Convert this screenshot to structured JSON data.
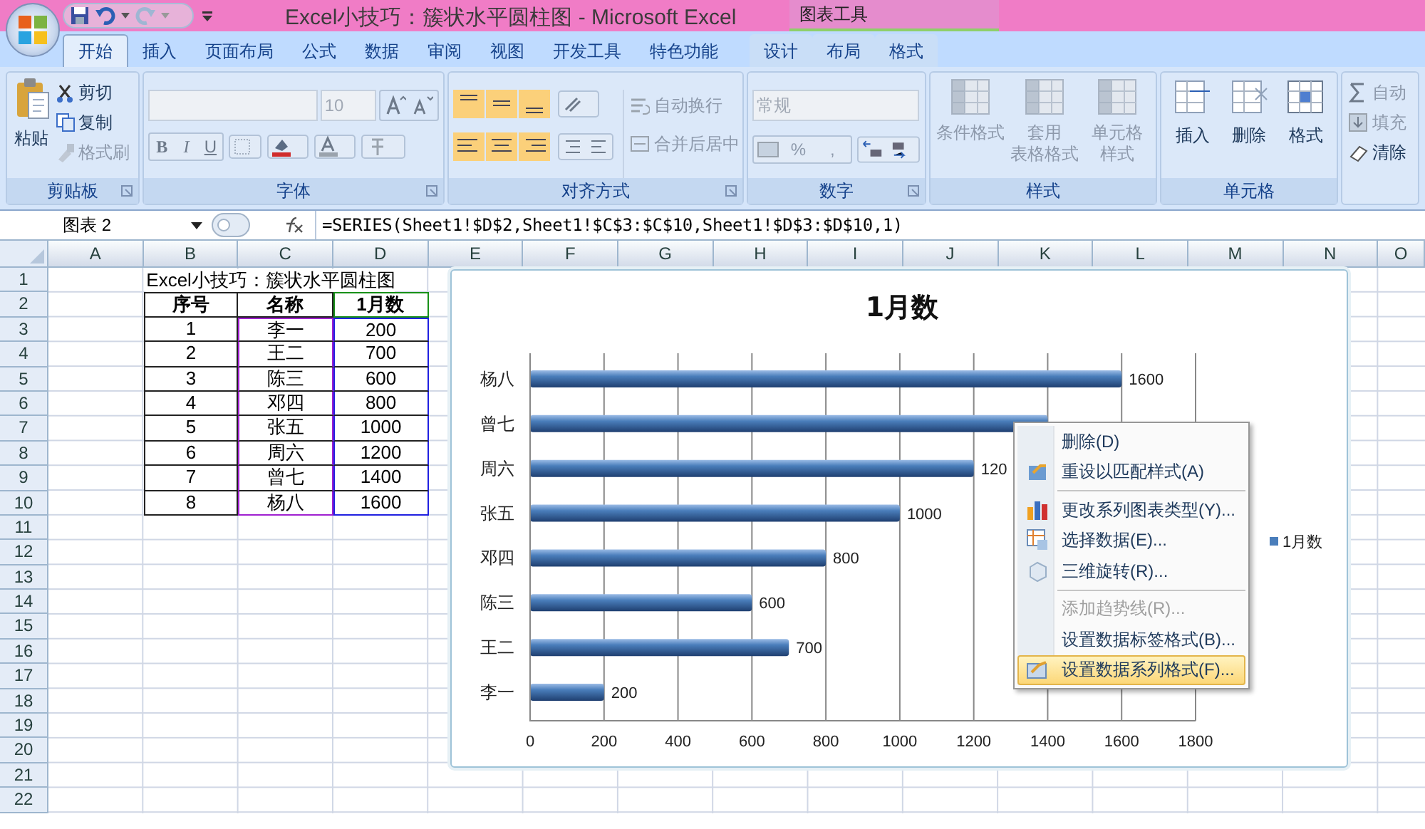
{
  "title_bar": {
    "title": "Excel小技巧：簇状水平圆柱图 - Microsoft Excel",
    "context_label": "图表工具"
  },
  "ribbon_tabs": [
    {
      "label": "开始",
      "selected": true,
      "kind": "standard"
    },
    {
      "label": "插入",
      "selected": false,
      "kind": "standard"
    },
    {
      "label": "页面布局",
      "selected": false,
      "kind": "standard"
    },
    {
      "label": "公式",
      "selected": false,
      "kind": "standard"
    },
    {
      "label": "数据",
      "selected": false,
      "kind": "standard"
    },
    {
      "label": "审阅",
      "selected": false,
      "kind": "standard"
    },
    {
      "label": "视图",
      "selected": false,
      "kind": "standard"
    },
    {
      "label": "开发工具",
      "selected": false,
      "kind": "standard"
    },
    {
      "label": "特色功能",
      "selected": false,
      "kind": "standard"
    },
    {
      "label": "设计",
      "selected": false,
      "kind": "contextual"
    },
    {
      "label": "布局",
      "selected": false,
      "kind": "contextual"
    },
    {
      "label": "格式",
      "selected": false,
      "kind": "contextual"
    }
  ],
  "clipboard": {
    "label": "剪贴板",
    "paste": "粘贴",
    "items": [
      {
        "label": "剪切",
        "disabled": false
      },
      {
        "label": "复制",
        "disabled": false
      },
      {
        "label": "格式刷",
        "disabled": true
      }
    ]
  },
  "font": {
    "label": "字体",
    "font_size": "10",
    "buttons": [
      "B",
      "I",
      "U"
    ]
  },
  "alignment": {
    "label": "对齐方式",
    "items": [
      {
        "label": "自动换行",
        "disabled": true
      },
      {
        "label": "合并后居中",
        "disabled": true
      }
    ]
  },
  "number": {
    "label": "数字",
    "format": "常规",
    "buttons": [
      "%",
      ","
    ]
  },
  "styles": {
    "label": "样式",
    "items": [
      {
        "lines": [
          "条件格式"
        ],
        "disabled": true
      },
      {
        "lines": [
          "套用",
          "表格格式"
        ],
        "disabled": true
      },
      {
        "lines": [
          "单元格",
          "样式"
        ],
        "disabled": true
      }
    ]
  },
  "cells": {
    "label": "单元格",
    "items": [
      {
        "label": "插入",
        "disabled": false
      },
      {
        "label": "删除",
        "disabled": false
      },
      {
        "label": "格式",
        "disabled": false
      }
    ]
  },
  "editing": {
    "items": [
      {
        "label": "自动",
        "disabled": true
      },
      {
        "label": "填充",
        "disabled": true
      },
      {
        "label": "清除",
        "disabled": false
      }
    ]
  },
  "formula_bar": {
    "name_box": "图表 2",
    "formula": "=SERIES(Sheet1!$D$2,Sheet1!$C$3:$C$10,Sheet1!$D$3:$D$10,1)"
  },
  "sheet": {
    "columns": [
      "A",
      "B",
      "C",
      "D",
      "E",
      "F",
      "G",
      "H",
      "I",
      "J",
      "K",
      "L",
      "M",
      "N",
      "O"
    ],
    "rows": [
      "1",
      "2",
      "3",
      "4",
      "5",
      "6",
      "7",
      "8",
      "9",
      "10",
      "11",
      "12",
      "13",
      "14",
      "15",
      "16",
      "17",
      "18",
      "19",
      "20",
      "21",
      "22"
    ],
    "caption": "Excel小技巧：簇状水平圆柱图",
    "table": {
      "columns": [
        {
          "header": "序号"
        },
        {
          "header": "名称",
          "color": "#a020d0"
        },
        {
          "header": "1月数",
          "color": "#2020e0",
          "header_outline": {
            "color": "#189018"
          }
        }
      ],
      "rows": [
        [
          "1",
          "李一",
          "200"
        ],
        [
          "2",
          "王二",
          "700"
        ],
        [
          "3",
          "陈三",
          "600"
        ],
        [
          "4",
          "邓四",
          "800"
        ],
        [
          "5",
          "张五",
          "1000"
        ],
        [
          "6",
          "周六",
          "1200"
        ],
        [
          "7",
          "曾七",
          "1400"
        ],
        [
          "8",
          "杨八",
          "1600"
        ]
      ]
    }
  },
  "chart": {
    "chart_data": {
      "type": "bar",
      "orientation": "horizontal",
      "title": "1月数",
      "categories": [
        "杨八",
        "曾七",
        "周六",
        "张五",
        "邓四",
        "陈三",
        "王二",
        "李一"
      ],
      "series": [
        {
          "name": "1月数",
          "color": "#4a7ebb",
          "values": [
            1600,
            1400,
            1200,
            1000,
            800,
            600,
            700,
            200
          ]
        }
      ],
      "grid": true,
      "xlim": [
        0,
        1800
      ],
      "xticks": [
        0,
        200,
        400,
        600,
        800,
        1000,
        1200,
        1400,
        1600,
        1800
      ],
      "value_labels": [
        "1600",
        null,
        "120",
        "1000",
        "800",
        "600",
        "700",
        "200"
      ]
    }
  },
  "context_menu": [
    {
      "label": "删除(D)",
      "kind": "plain",
      "disabled": false,
      "selected": false
    },
    {
      "label": "重设以匹配样式(A)",
      "kind": "restyle",
      "disabled": false,
      "selected": false
    },
    {
      "kind": "separator"
    },
    {
      "label": "更改系列图表类型(Y)...",
      "kind": "chart-type",
      "disabled": false,
      "selected": false
    },
    {
      "label": "选择数据(E)...",
      "kind": "data",
      "disabled": false,
      "selected": false
    },
    {
      "label": "三维旋转(R)...",
      "kind": "rotate",
      "disabled": false,
      "selected": false
    },
    {
      "kind": "separator"
    },
    {
      "label": "添加趋势线(R)...",
      "kind": "plain",
      "disabled": true,
      "selected": false
    },
    {
      "label": "设置数据标签格式(B)...",
      "kind": "plain",
      "disabled": false,
      "selected": false
    },
    {
      "label": "设置数据系列格式(F)...",
      "kind": "format",
      "disabled": false,
      "selected": true
    }
  ]
}
